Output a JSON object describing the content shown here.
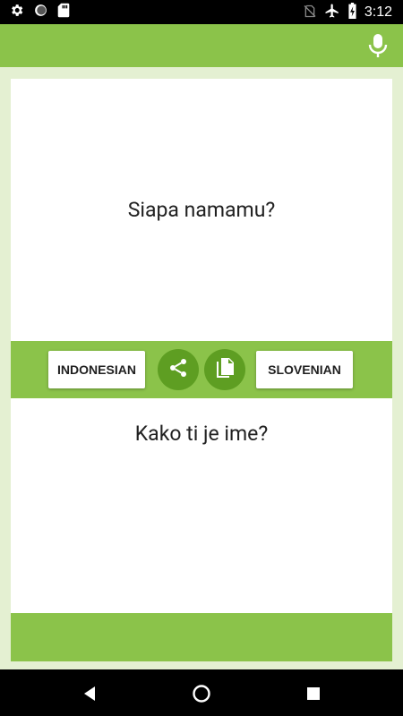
{
  "status_bar": {
    "time": "3:12",
    "icons": [
      "settings-icon",
      "circle-icon",
      "sd-card-icon",
      "no-sim-icon",
      "airplane-icon",
      "battery-charging-icon"
    ]
  },
  "toolbar": {
    "mic_icon": "mic-icon",
    "color": "#8bc34a"
  },
  "translation": {
    "source_text": "Siapa namamu?",
    "target_text": "Kako ti je ime?"
  },
  "languages": {
    "source": "INDONESIAN",
    "target": "SLOVENIAN"
  },
  "actions": {
    "share_icon": "share-icon",
    "copy_icon": "copy-icon",
    "button_color": "#5e9e22"
  },
  "nav": {
    "icons": [
      "back-icon",
      "home-icon",
      "recents-icon"
    ]
  }
}
